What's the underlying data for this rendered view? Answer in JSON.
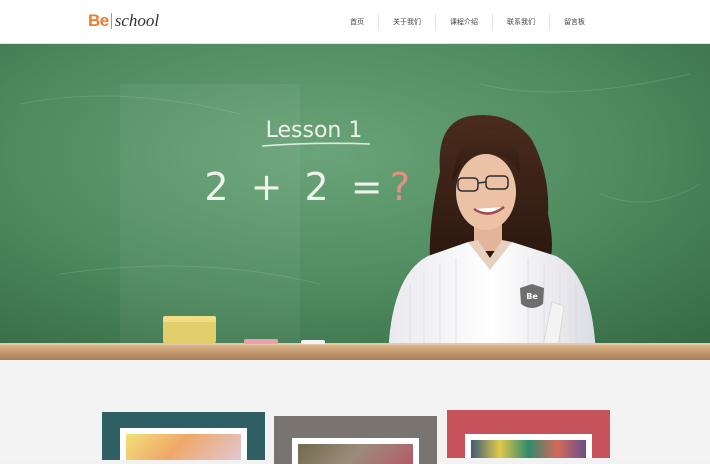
{
  "logo": {
    "be": "Be",
    "school": "school"
  },
  "nav": {
    "items": [
      {
        "label": "首页"
      },
      {
        "label": "关于我们"
      },
      {
        "label": "课程介绍"
      },
      {
        "label": "联系我们"
      },
      {
        "label": "留言板"
      }
    ]
  },
  "hero": {
    "chalk_title": "Lesson 1",
    "chalk_equation": "2 + 2 =",
    "chalk_question": "?",
    "badge_text": "Be"
  },
  "colors": {
    "brand_orange": "#f07c2a",
    "chalkboard": "#4f8a5e",
    "card1": "#2e5f63",
    "card2": "#7a7470",
    "card3": "#c6525c"
  }
}
